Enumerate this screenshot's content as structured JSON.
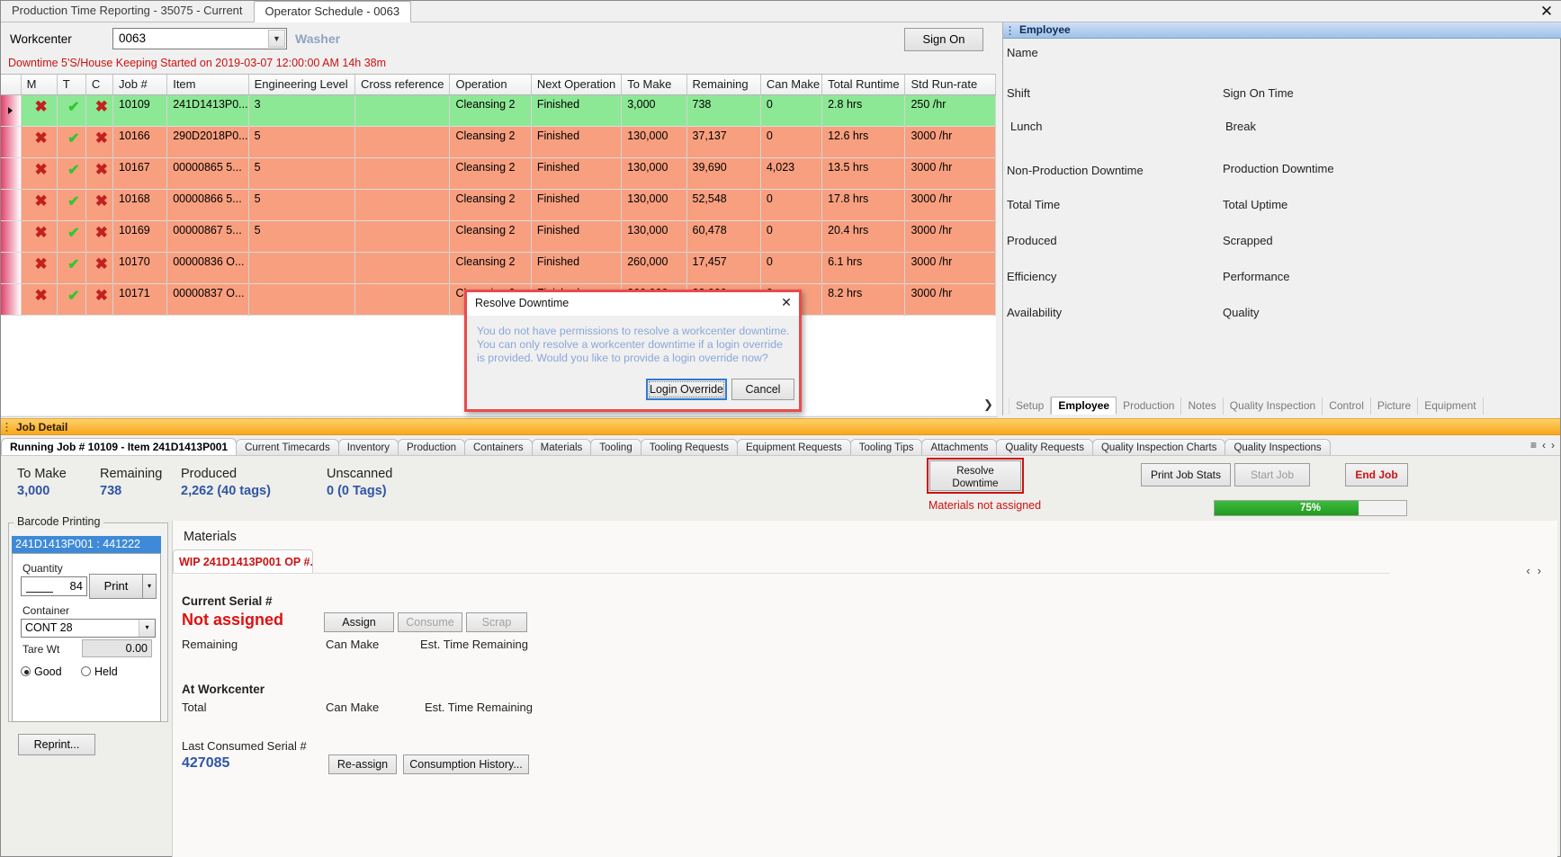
{
  "window": {
    "tabs": [
      {
        "label": "Production Time Reporting - 35075 - Current",
        "active": false
      },
      {
        "label": "Operator Schedule - 0063",
        "active": true
      }
    ],
    "close_icon": "✕"
  },
  "workcenter": {
    "label": "Workcenter",
    "value": "0063",
    "name": "Washer",
    "sign_on_label": "Sign On",
    "downtime_message": "Downtime 5'S/House Keeping Started on 2019-03-07 12:00:00 AM 14h 38m"
  },
  "grid": {
    "columns": [
      "M",
      "T",
      "C",
      "Job #",
      "Item",
      "Engineering Level",
      "Cross reference",
      "Operation",
      "Next Operation",
      "To Make",
      "Remaining",
      "Can Make",
      "Total Runtime",
      "Std Run-rate"
    ],
    "rows": [
      {
        "m": "✖",
        "t": "✔",
        "c": "✖",
        "job": "10109",
        "item": "241D1413P0...",
        "eng": "3",
        "xref": "",
        "op": "Cleansing 2",
        "next": "Finished",
        "tomake": "3,000",
        "remaining": "738",
        "canmake": "0",
        "runtime": "2.8 hrs",
        "rate": "250 /hr",
        "state": "green"
      },
      {
        "m": "✖",
        "t": "✔",
        "c": "✖",
        "job": "10166",
        "item": "290D2018P0...",
        "eng": "5",
        "xref": "",
        "op": "Cleansing 2",
        "next": "Finished",
        "tomake": "130,000",
        "remaining": "37,137",
        "canmake": "0",
        "runtime": "12.6 hrs",
        "rate": "3000 /hr",
        "state": "orange"
      },
      {
        "m": "✖",
        "t": "✔",
        "c": "✖",
        "job": "10167",
        "item": "00000865  5...",
        "eng": "5",
        "xref": "",
        "op": "Cleansing 2",
        "next": "Finished",
        "tomake": "130,000",
        "remaining": "39,690",
        "canmake": "4,023",
        "runtime": "13.5 hrs",
        "rate": "3000 /hr",
        "state": "orange"
      },
      {
        "m": "✖",
        "t": "✔",
        "c": "✖",
        "job": "10168",
        "item": "00000866  5...",
        "eng": "5",
        "xref": "",
        "op": "Cleansing 2",
        "next": "Finished",
        "tomake": "130,000",
        "remaining": "52,548",
        "canmake": "0",
        "runtime": "17.8 hrs",
        "rate": "3000 /hr",
        "state": "orange"
      },
      {
        "m": "✖",
        "t": "✔",
        "c": "✖",
        "job": "10169",
        "item": "00000867  5...",
        "eng": "5",
        "xref": "",
        "op": "Cleansing 2",
        "next": "Finished",
        "tomake": "130,000",
        "remaining": "60,478",
        "canmake": "0",
        "runtime": "20.4 hrs",
        "rate": "3000 /hr",
        "state": "orange"
      },
      {
        "m": "✖",
        "t": "✔",
        "c": "✖",
        "job": "10170",
        "item": "00000836  O...",
        "eng": "",
        "xref": "",
        "op": "Cleansing 2",
        "next": "Finished",
        "tomake": "260,000",
        "remaining": "17,457",
        "canmake": "0",
        "runtime": "6.1 hrs",
        "rate": "3000 /hr",
        "state": "orange"
      },
      {
        "m": "✖",
        "t": "✔",
        "c": "✖",
        "job": "10171",
        "item": "00000837  O...",
        "eng": "",
        "xref": "",
        "op": "Cleansing 2",
        "next": "Finished",
        "tomake": "260,000",
        "remaining": "23,000",
        "canmake": "0",
        "runtime": "8.2 hrs",
        "rate": "3000 /hr",
        "state": "orange"
      }
    ]
  },
  "employee_panel": {
    "header": "Employee",
    "fields_left": [
      "Name",
      "Shift",
      "Lunch",
      "Non-Production Downtime",
      "Total Time",
      "Produced",
      "Efficiency",
      "Availability"
    ],
    "fields_right": [
      "Sign On Time",
      "Break",
      "Production Downtime",
      "Total Uptime",
      "Scrapped",
      "Performance",
      "Quality"
    ],
    "tabs": [
      "Setup",
      "Employee",
      "Production",
      "Notes",
      "Quality Inspection",
      "Control",
      "Picture",
      "Equipment"
    ],
    "active_tab": "Employee",
    "expand_icon": "❯"
  },
  "job_detail": {
    "header": "Job Detail",
    "tabs": [
      "Running Job # 10109 - Item 241D1413P001",
      "Current Timecards",
      "Inventory",
      "Production",
      "Containers",
      "Materials",
      "Tooling",
      "Tooling Requests",
      "Equipment Requests",
      "Tooling Tips",
      "Attachments",
      "Quality Requests",
      "Quality Inspection Charts",
      "Quality Inspections"
    ],
    "active_tab": "Running Job # 10109 - Item 241D1413P001",
    "nav_down": "≡",
    "nav_left": "‹",
    "nav_right": "›",
    "stats": [
      {
        "label": "To Make",
        "value": "3,000"
      },
      {
        "label": "Remaining",
        "value": "738"
      },
      {
        "label": "Produced",
        "value": "2,262 (40 tags)"
      },
      {
        "label": "Unscanned",
        "value": "0 (0 Tags)"
      }
    ],
    "resolve_downtime_label": "Resolve\nDowntime",
    "resolve_downtime_line1": "Resolve",
    "resolve_downtime_line2": "Downtime",
    "materials_warning": "Materials not assigned",
    "print_job_stats_label": "Print Job Stats",
    "start_job_label": "Start Job",
    "end_job_label": "End Job",
    "progress_percent": "75%"
  },
  "barcode_printing": {
    "legend": "Barcode Printing",
    "selected_item": "241D1413P001 : 441222",
    "quantity_label": "Quantity",
    "quantity_value": "84",
    "print_label": "Print",
    "print_dropdown_icon": "▾",
    "container_label": "Container",
    "container_value": "CONT 28",
    "container_arrow": "▾",
    "tare_label": "Tare Wt",
    "tare_value": "0.00",
    "good_label": "Good",
    "held_label": "Held",
    "reprint_label": "Reprint..."
  },
  "materials": {
    "title": "Materials",
    "tab_label": "WIP 241D1413P001 OP #...",
    "nav_left": "‹",
    "nav_right": "›",
    "current_serial_label": "Current Serial #",
    "current_serial_value": "Not assigned",
    "remaining_label": "Remaining",
    "can_make_label": "Can Make",
    "est_time_label": "Est. Time Remaining",
    "assign_label": "Assign",
    "consume_label": "Consume",
    "scrap_label": "Scrap",
    "at_workcenter_label": "At Workcenter",
    "total_label": "Total",
    "can_make_label2": "Can Make",
    "est_time_label2": "Est. Time Remaining",
    "last_consumed_label": "Last Consumed Serial #",
    "last_consumed_value": "427085",
    "reassign_label": "Re-assign",
    "consumption_history_label": "Consumption History..."
  },
  "dialog": {
    "title": "Resolve Downtime",
    "close_icon": "✕",
    "message": "You do not have permissions to resolve a workcenter downtime. You can only resolve a workcenter downtime if a login override is provided. Would you like to provide a login override now?",
    "primary_button": "Login Override",
    "secondary_button": "Cancel"
  },
  "colors": {
    "row_green": "#8de895",
    "row_orange": "#f79f7f",
    "accent_blue": "#2f55a4",
    "alert_red": "#cc1111",
    "progress_green": "#2fae2f"
  }
}
